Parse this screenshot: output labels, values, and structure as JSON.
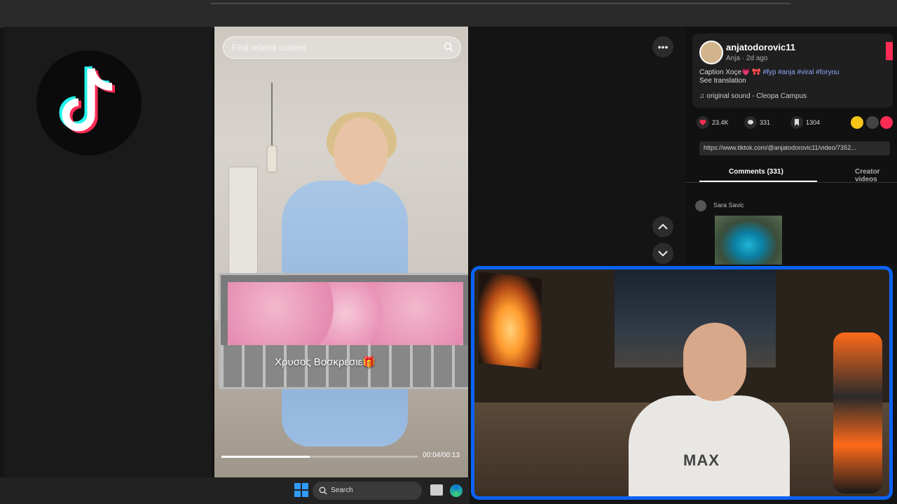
{
  "topbar": {},
  "video": {
    "search_placeholder": "Find related content",
    "caption": "Χρυσος Βοσκρεσιε🎁",
    "progress_fraction": 0.45,
    "time": "00:04/00:13"
  },
  "post": {
    "username": "anjatodorovic11",
    "meta": "Anja · 2d ago",
    "description": "Caption Xoçe💗 🎀",
    "tags": "#fyp #anja #viral #foryou",
    "see_translation": "See translation",
    "sound": "♫ original sound - Cleopa Campus",
    "likes": "23.4K",
    "comments": "331",
    "saves": "1304",
    "url": "https://www.tiktok.com/@anjatodorovic11/video/7352...",
    "tab_comments": "Comments (331)",
    "tab_creator": "Creator videos",
    "comment_user": "Sara Savic"
  },
  "taskbar": {
    "search_label": "Search"
  },
  "colors": {
    "accent": "#fe2c55",
    "webcam_border": "#0b63f6"
  },
  "icons": [
    "tiktok-logo",
    "search-icon",
    "more-icon",
    "chevron-up-icon",
    "chevron-down-icon",
    "heart-icon",
    "comment-icon",
    "bookmark-icon",
    "windows-icon",
    "edge-icon"
  ],
  "webcam": {
    "shirt_text": "MAX"
  }
}
